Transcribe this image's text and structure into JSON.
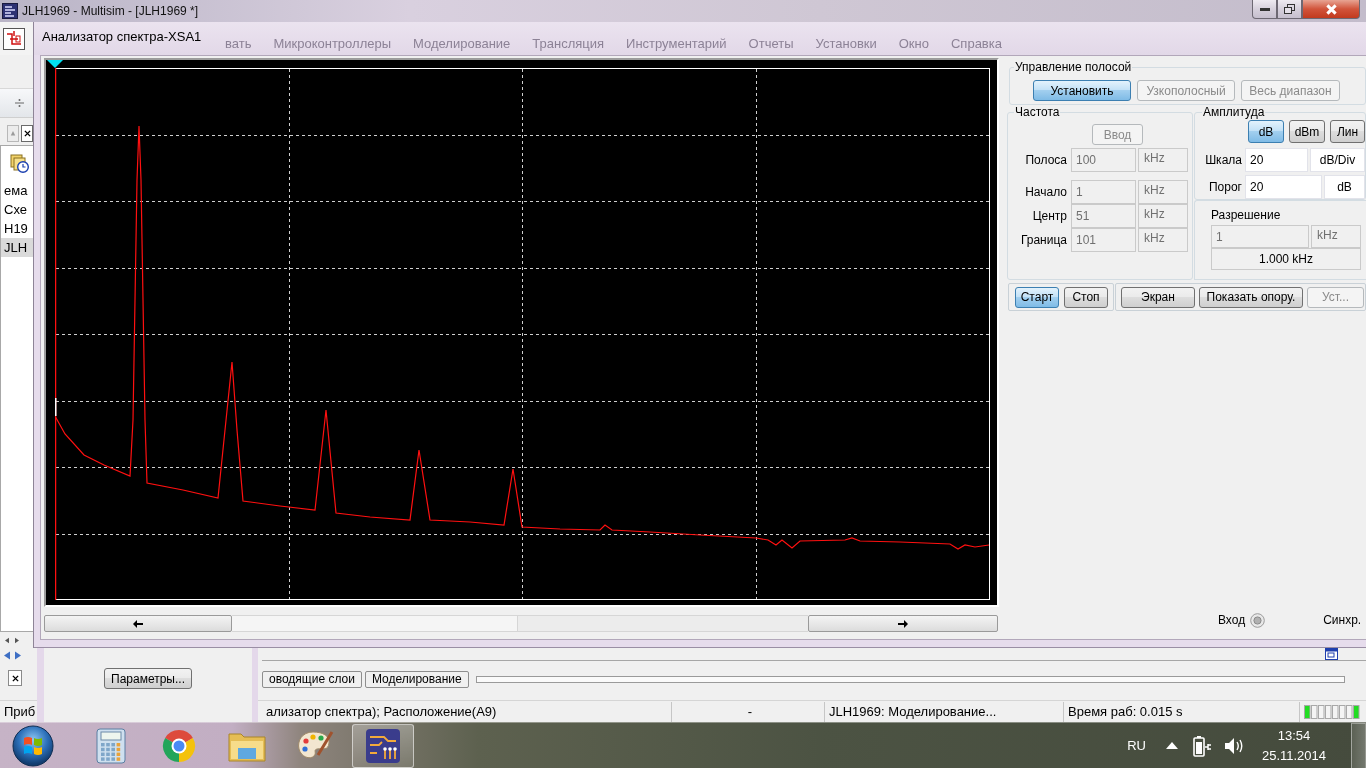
{
  "multisim": {
    "title": "JLH1969 - Multisim - [JLH1969 *]",
    "menu": [
      "вать",
      "Микроконтроллеры",
      "Моделирование",
      "Трансляция",
      "Инструментарий",
      "Отчеты",
      "Установки",
      "Окно",
      "Справка"
    ],
    "tree": [
      {
        "label": "ема",
        "selected": false
      },
      {
        "label": "Схе",
        "selected": false
      },
      {
        "label": "H19",
        "selected": false
      },
      {
        "label": "JLH",
        "selected": true
      }
    ],
    "tabs": [
      {
        "label": "оводящие слои",
        "selected": false
      },
      {
        "label": "Моделирование",
        "selected": false
      }
    ],
    "status_bar": [
      "Приб",
      "ализатор спектра); Расположение(А9)",
      "-",
      "JLH1969: Моделирование...",
      "Время раб: 0.015 s"
    ]
  },
  "parameters_panel": {
    "button": "Параметры..."
  },
  "analyzer": {
    "title": "Анализатор спектра-XSA1",
    "span_control": {
      "title": "Управление полосой",
      "buttons": [
        {
          "label": "Установить",
          "selected": true,
          "disabled": false
        },
        {
          "label": "Узкополосный",
          "selected": false,
          "disabled": true
        },
        {
          "label": "Весь диапазон",
          "selected": false,
          "disabled": true
        }
      ]
    },
    "frequency": {
      "title": "Частота",
      "enter_button": {
        "label": "Ввод",
        "disabled": true
      },
      "fields": [
        {
          "label": "Полоса",
          "value": "100",
          "unit": "kHz",
          "disabled": true
        },
        {
          "label": "Начало",
          "value": "1",
          "unit": "kHz",
          "disabled": true
        },
        {
          "label": "Центр",
          "value": "51",
          "unit": "kHz",
          "disabled": true
        },
        {
          "label": "Граница",
          "value": "101",
          "unit": "kHz",
          "disabled": true
        }
      ]
    },
    "amplitude": {
      "title": "Амплитуда",
      "buttons": [
        {
          "label": "dB",
          "selected": true
        },
        {
          "label": "dBm",
          "selected": false
        },
        {
          "label": "Лин",
          "selected": false
        }
      ],
      "fields": [
        {
          "label": "Шкала",
          "value": "20",
          "unit": "dB/Div",
          "disabled": false
        },
        {
          "label": "Порог",
          "value": "20",
          "unit": "dB",
          "disabled": false
        }
      ]
    },
    "resolution": {
      "title": "Разрешение",
      "value": "1",
      "unit": "kHz",
      "disabled": true,
      "readout": "1.000 kHz"
    },
    "run_buttons": [
      {
        "label": "Старт",
        "selected": true
      },
      {
        "label": "Стоп",
        "selected": false
      }
    ],
    "display_buttons": [
      {
        "label": "Экран",
        "disabled": false
      },
      {
        "label": "Показать опору.",
        "disabled": false
      },
      {
        "label": "Уст...",
        "disabled": true
      }
    ],
    "terminals": [
      {
        "label": "Вход",
        "connector": true
      },
      {
        "label": "Синхр.",
        "connector": false
      }
    ]
  },
  "taskbar": {
    "apps": [
      {
        "kind": "calculator",
        "active": false
      },
      {
        "kind": "browser",
        "active": false
      },
      {
        "kind": "folder",
        "active": false
      },
      {
        "kind": "palette",
        "active": false
      },
      {
        "kind": "circuit",
        "active": true
      }
    ],
    "language": "RU",
    "time": "13:54",
    "date": "25.11.2014"
  }
}
